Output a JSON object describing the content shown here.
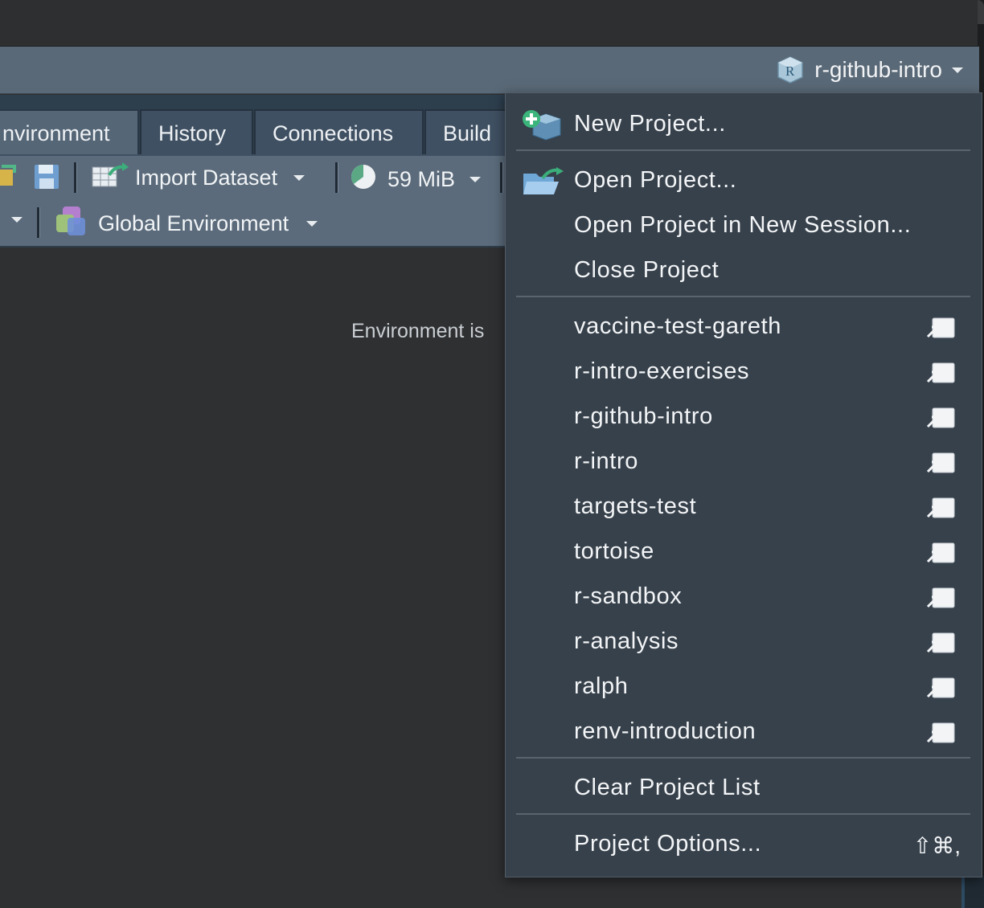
{
  "toolbar": {
    "project_name": "r-github-intro"
  },
  "tabs": [
    {
      "label": "nvironment"
    },
    {
      "label": "History"
    },
    {
      "label": "Connections"
    },
    {
      "label": "Build"
    }
  ],
  "env_toolbar": {
    "import_label": "Import Dataset",
    "memory_label": "59 MiB",
    "env_select": "Global Environment"
  },
  "pane": {
    "empty_message": "Environment is"
  },
  "project_menu": {
    "new_project": "New Project...",
    "open_project": "Open Project...",
    "open_new_session": "Open Project in New Session...",
    "close_project": "Close Project",
    "recent_projects": [
      "vaccine-test-gareth",
      "r-intro-exercises",
      "r-github-intro",
      "r-intro",
      "targets-test",
      "tortoise",
      "r-sandbox",
      "r-analysis",
      "ralph",
      "renv-introduction"
    ],
    "clear_list": "Clear Project List",
    "project_options": "Project Options...",
    "project_options_shortcut": "⇧⌘,"
  },
  "colors": {
    "menu_bg": "#37414b",
    "toolbar_bg": "#5a6977",
    "tab_bg": "#3f5062"
  }
}
